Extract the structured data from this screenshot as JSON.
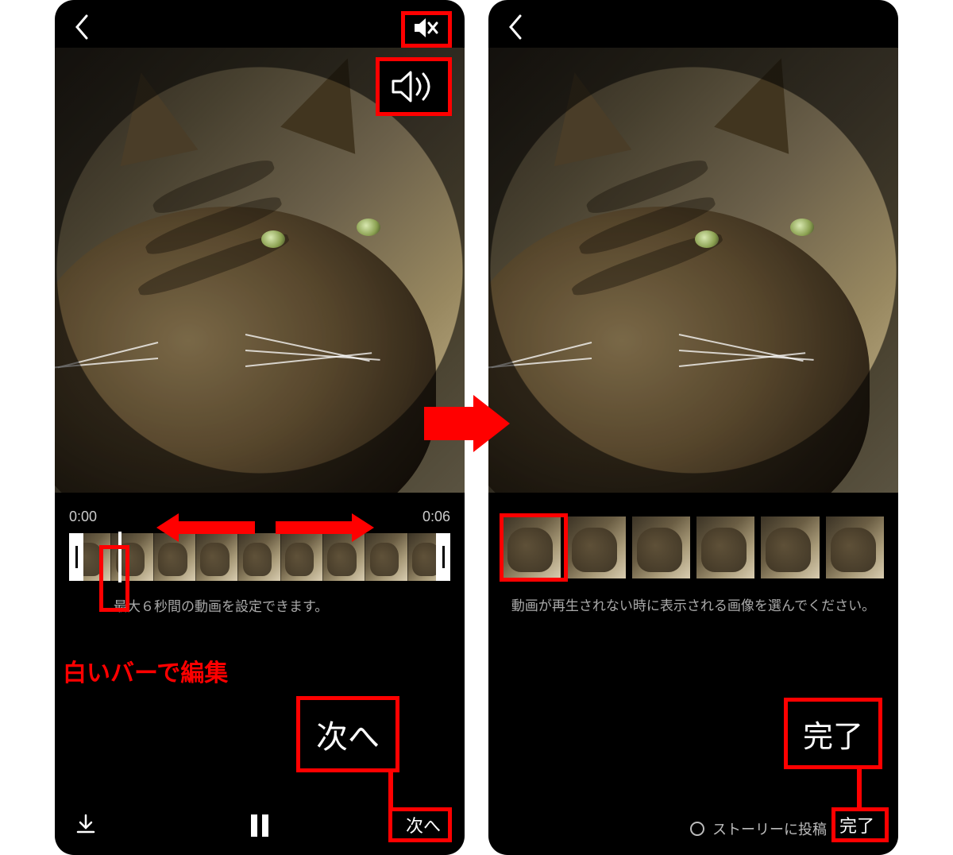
{
  "left": {
    "time_start": "0:00",
    "time_end": "0:06",
    "hint": "最大６秒間の動画を設定できます。",
    "next_label": "次へ"
  },
  "right": {
    "hint": "動画が再生されない時に表示される画像を選んでください。",
    "story_label": "ストーリーに投稿",
    "done_label": "完了"
  },
  "annotations": {
    "white_bar_label": "白いバーで編集",
    "next_callout": "次へ",
    "done_callout": "完了"
  },
  "icons": {
    "back": "back-chevron",
    "mute": "speaker-muted",
    "sound": "speaker-on",
    "download": "download",
    "pause": "pause",
    "radio": "radio-unchecked"
  }
}
